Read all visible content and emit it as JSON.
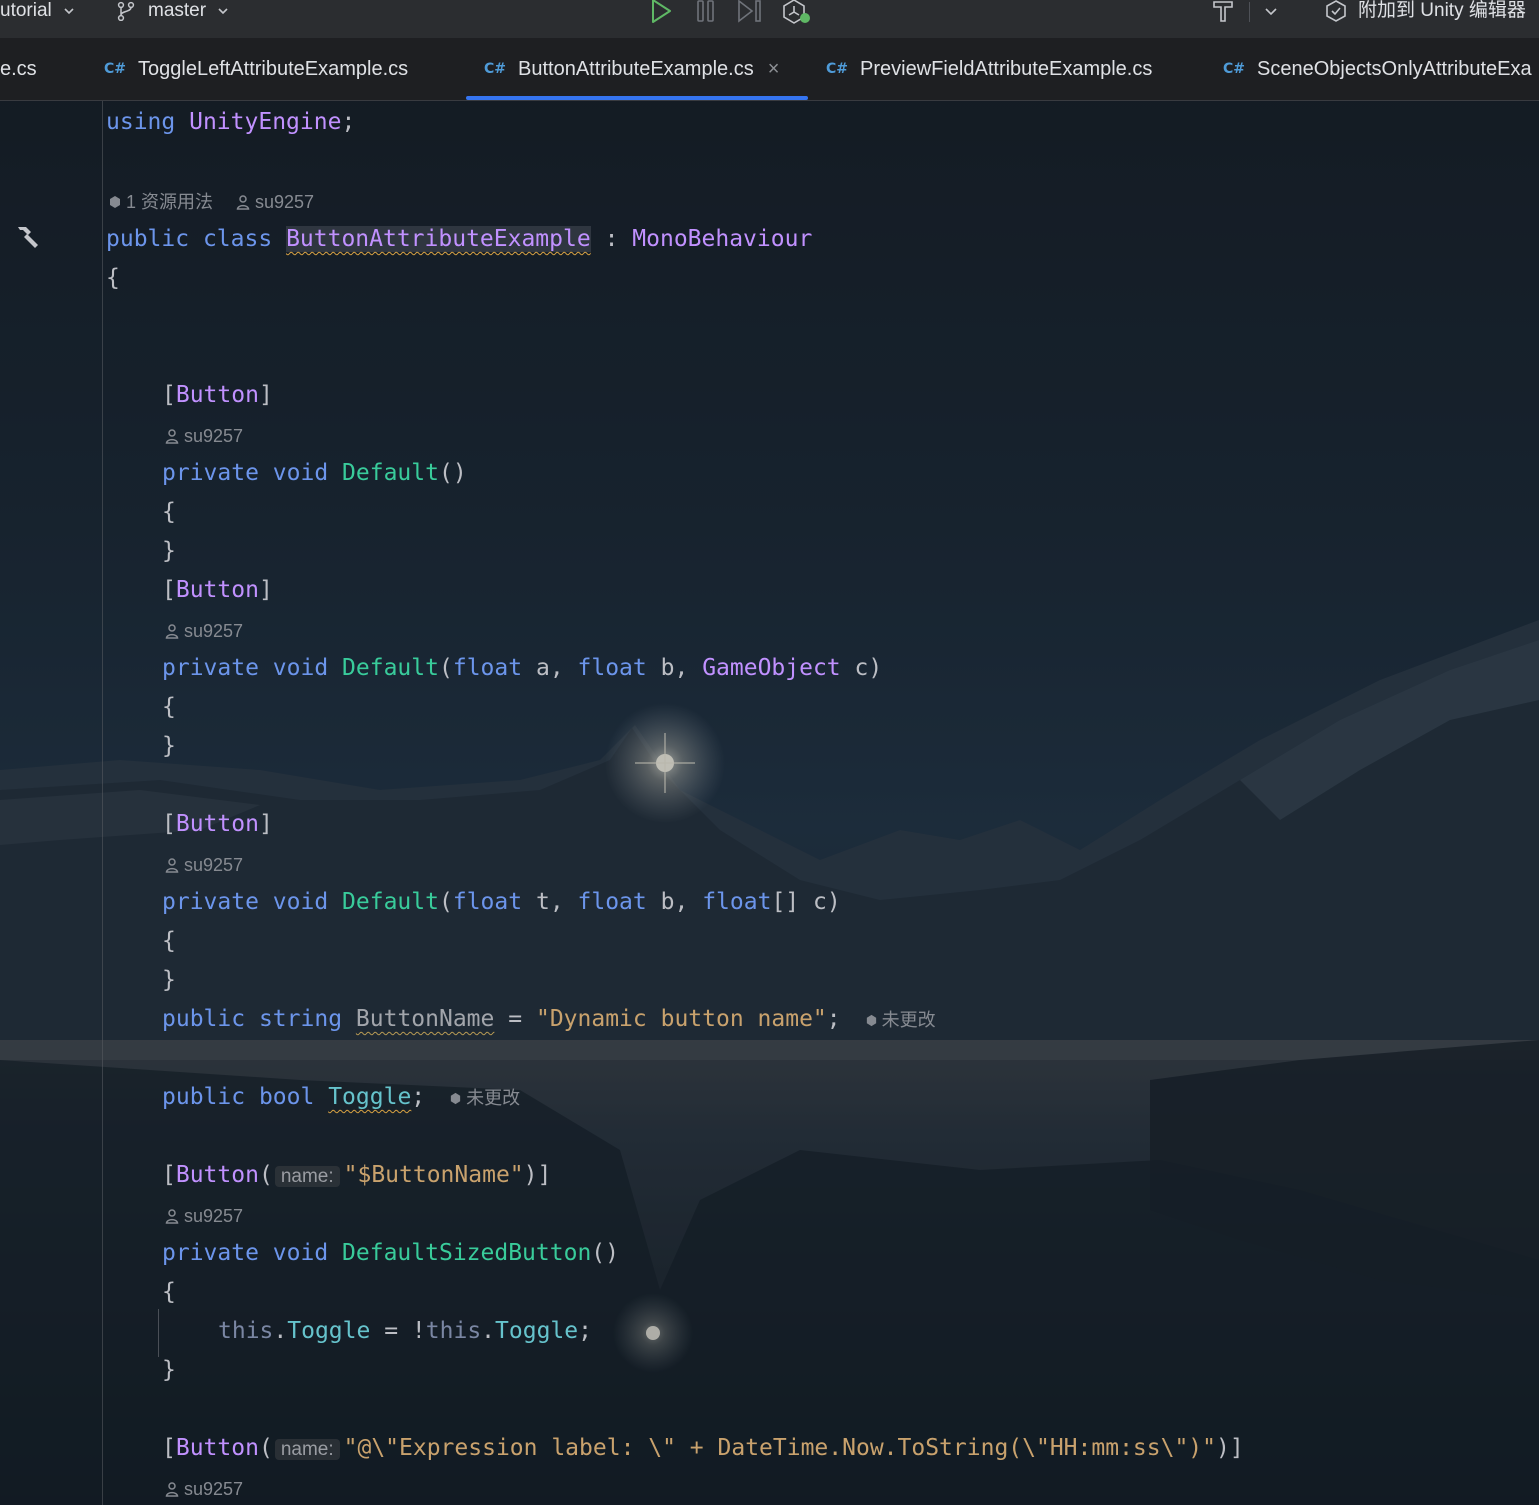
{
  "toolbar": {
    "project_label": "utorial",
    "branch_label": "master",
    "attach_label": "附加到 Unity 编辑器",
    "icons": [
      "chevron-down-icon",
      "git-branch-icon",
      "run-icon",
      "pause-icon",
      "step-icon",
      "debug-unity-icon",
      "build-hammer-icon",
      "attach-unity-icon"
    ]
  },
  "tabs": [
    {
      "label": "e.cs",
      "active": false
    },
    {
      "label": "ToggleLeftAttributeExample.cs",
      "active": false
    },
    {
      "label": "ButtonAttributeExample.cs",
      "active": true
    },
    {
      "label": "PreviewFieldAttributeExample.cs",
      "active": false
    },
    {
      "label": "SceneObjectsOnlyAttributeExa",
      "active": false
    }
  ],
  "tab_lang_badge": "C#",
  "editor": {
    "hints": {
      "usages": "1 资源用法",
      "author": "su9257",
      "unchanged": "未更改",
      "param_name": "name:"
    },
    "code": {
      "l_using_kw": "using",
      "l_using_ns": "UnityEngine",
      "l_semicolon": ";",
      "kw_public": "public",
      "kw_class": "class",
      "class_name": "ButtonAttributeExample",
      "colon": ":",
      "base_class": "MonoBehaviour",
      "brace_open": "{",
      "brace_close": "}",
      "attr_button": "Button",
      "bracket_open": "[",
      "bracket_close": "]",
      "kw_private": "private",
      "kw_void": "void",
      "fn_default": "Default",
      "parens_empty": "()",
      "kw_float": "float",
      "kw_float_array": "float",
      "array_brackets": "[]",
      "go_type": "GameObject",
      "p_a": "a",
      "p_b": "b",
      "p_c": "c",
      "p_t": "t",
      "kw_string": "string",
      "field_button_name": "ButtonName",
      "assign": "=",
      "str_dynamic": "\"Dynamic button name\"",
      "kw_bool": "bool",
      "field_toggle": "Toggle",
      "str_button_name_ref": "\"$ButtonName\"",
      "fn_default_sized": "DefaultSizedButton",
      "kw_this": "this",
      "not_op": "!",
      "str_expression": "\"@\\\"Expression label: \\\" + DateTime.Now.ToString(\\\"HH:mm:ss\\\")\""
    }
  },
  "colors": {
    "keyword": "#6c95eb",
    "class": "#c191ff",
    "method": "#39cc9b",
    "string": "#c9a26d",
    "field": "#66c3cc",
    "tab_underline": "#3574f0",
    "run_icon": "#5fb865"
  }
}
